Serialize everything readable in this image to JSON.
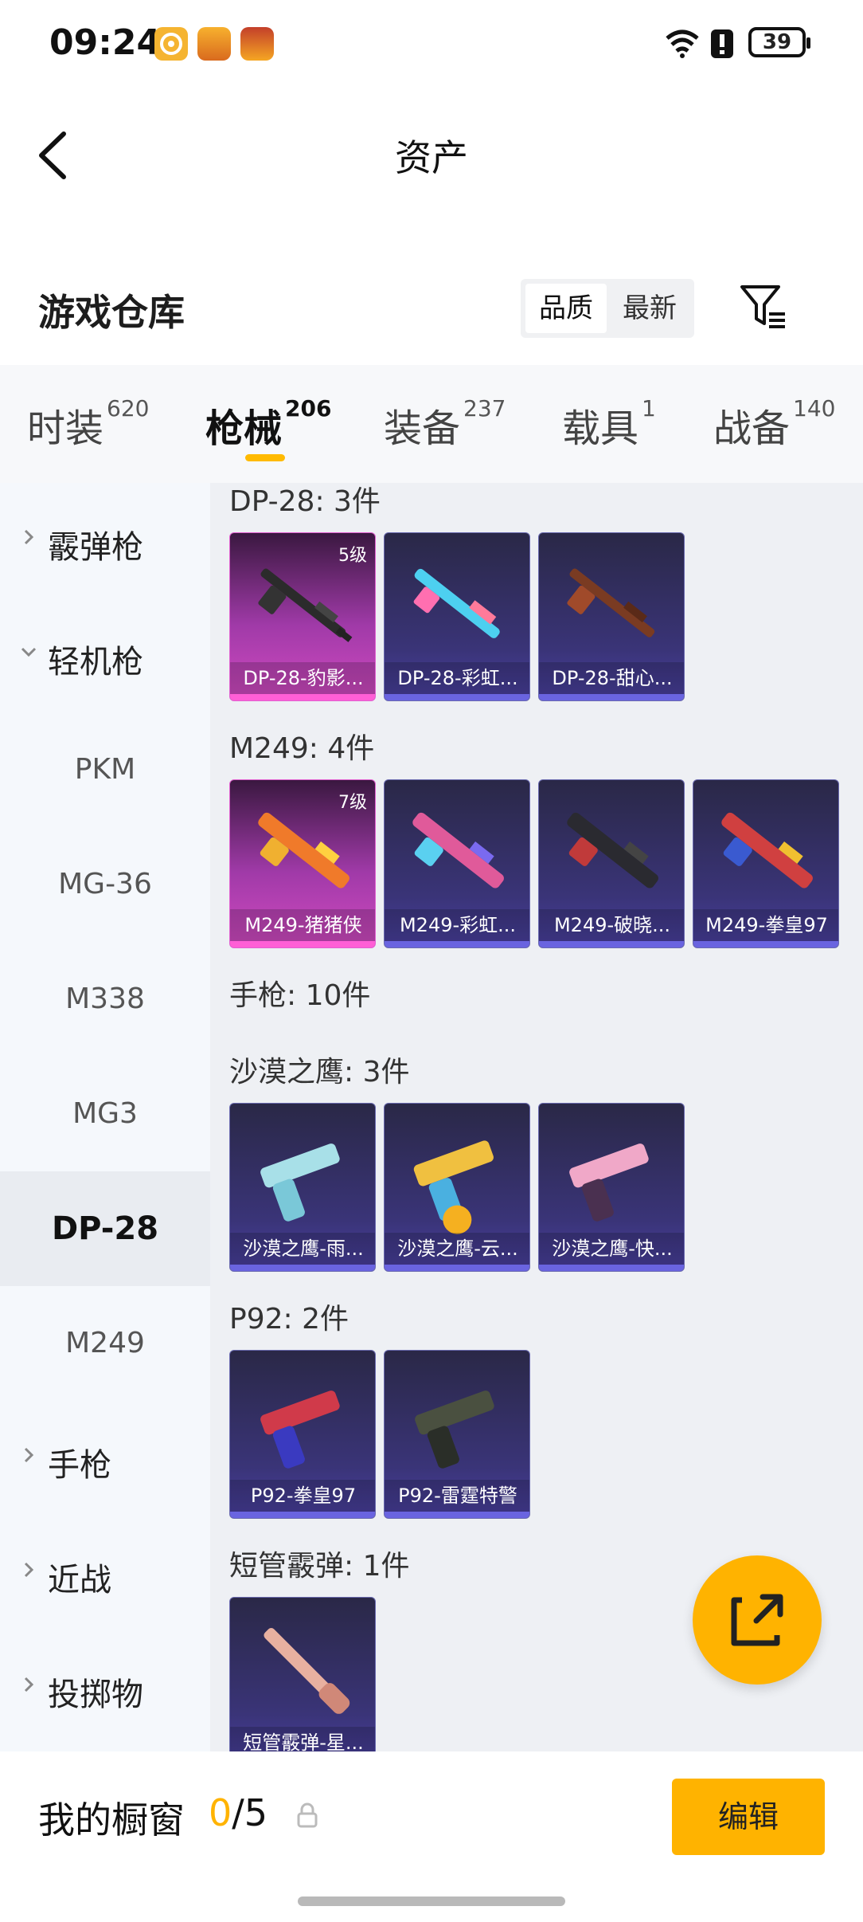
{
  "status_bar": {
    "time": "09:24",
    "battery": "39"
  },
  "header": {
    "title": "资产"
  },
  "warehouse": {
    "title": "游戏仓库",
    "sort_options": [
      "品质",
      "最新"
    ]
  },
  "tabs": [
    {
      "label": "时装",
      "count": "620"
    },
    {
      "label": "枪械",
      "count": "206"
    },
    {
      "label": "装备",
      "count": "237"
    },
    {
      "label": "载具",
      "count": "1"
    },
    {
      "label": "战备",
      "count": "140"
    }
  ],
  "sidebar": {
    "categories": [
      "霰弹枪",
      "轻机枪",
      "手枪",
      "近战",
      "投掷物"
    ],
    "sub_items": [
      "PKM",
      "MG-36",
      "M338",
      "MG3",
      "DP-28",
      "M249"
    ],
    "selected": "DP-28"
  },
  "content": {
    "groups": [
      {
        "title": "DP-28: 3件",
        "items": [
          {
            "name": "DP-28-豹影...",
            "level": "5级",
            "rarity": "pink"
          },
          {
            "name": "DP-28-彩虹...",
            "level": "",
            "rarity": "purple"
          },
          {
            "name": "DP-28-甜心...",
            "level": "",
            "rarity": "purple"
          }
        ]
      },
      {
        "title": "M249: 4件",
        "items": [
          {
            "name": "M249-猪猪侠",
            "level": "7级",
            "rarity": "pink"
          },
          {
            "name": "M249-彩虹...",
            "level": "",
            "rarity": "purple"
          },
          {
            "name": "M249-破晓...",
            "level": "",
            "rarity": "purple"
          },
          {
            "name": "M249-拳皇97",
            "level": "",
            "rarity": "purple"
          }
        ]
      },
      {
        "title": "手枪: 10件",
        "items": []
      },
      {
        "title": "沙漠之鹰: 3件",
        "items": [
          {
            "name": "沙漠之鹰-雨...",
            "level": "",
            "rarity": "purple"
          },
          {
            "name": "沙漠之鹰-云...",
            "level": "",
            "rarity": "purple"
          },
          {
            "name": "沙漠之鹰-快...",
            "level": "",
            "rarity": "purple"
          }
        ]
      },
      {
        "title": "P92: 2件",
        "items": [
          {
            "name": "P92-拳皇97",
            "level": "",
            "rarity": "purple"
          },
          {
            "name": "P92-雷霆特警",
            "level": "",
            "rarity": "purple"
          }
        ]
      },
      {
        "title": "短管霰弹: 1件",
        "items": [
          {
            "name": "短管霰弹-星...",
            "level": "",
            "rarity": "purple"
          }
        ]
      }
    ]
  },
  "showcase": {
    "title": "我的橱窗",
    "current": "0",
    "total": "/5",
    "edit_label": "编辑"
  },
  "colors": {
    "accent": "#ffb300",
    "pink_rarity": "#ff5fd6",
    "purple_rarity": "#6a64e0"
  }
}
